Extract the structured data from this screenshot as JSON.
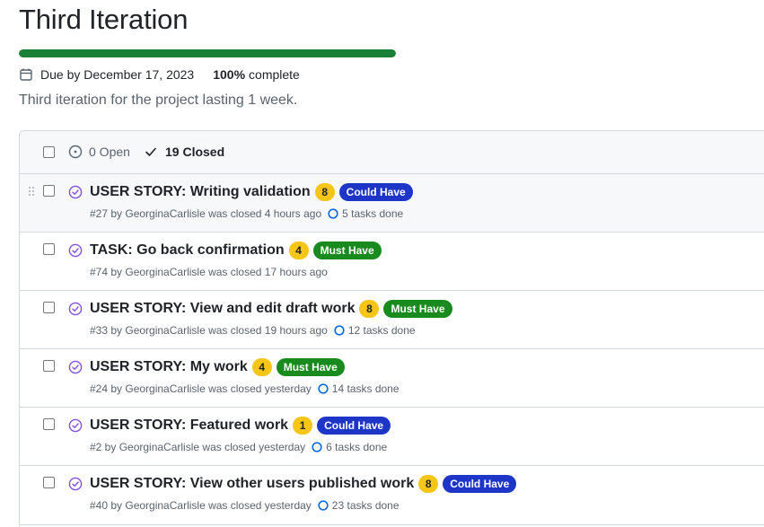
{
  "milestone": {
    "title": "Third Iteration",
    "progress_percent": 100,
    "due": "Due by December 17, 2023",
    "percent_label": "100%",
    "complete_word": "complete",
    "description": "Third iteration for the project lasting 1 week.",
    "accent_color": "#1a7f37"
  },
  "filters": {
    "open_label": "0 Open",
    "closed_label": "19 Closed"
  },
  "issues": [
    {
      "title": "USER STORY: Writing validation",
      "estimate": "8",
      "label": "Could Have",
      "meta": "#27 by GeorginaCarlisle was closed 4 hours ago",
      "tasks": "5 tasks done"
    },
    {
      "title": "TASK: Go back confirmation",
      "estimate": "4",
      "label": "Must Have",
      "meta": "#74 by GeorginaCarlisle was closed 17 hours ago",
      "tasks": ""
    },
    {
      "title": "USER STORY: View and edit draft work",
      "estimate": "8",
      "label": "Must Have",
      "meta": "#33 by GeorginaCarlisle was closed 19 hours ago",
      "tasks": "12 tasks done"
    },
    {
      "title": "USER STORY: My work",
      "estimate": "4",
      "label": "Must Have",
      "meta": "#24 by GeorginaCarlisle was closed yesterday",
      "tasks": "14 tasks done"
    },
    {
      "title": "USER STORY: Featured work",
      "estimate": "1",
      "label": "Could Have",
      "meta": "#2 by GeorginaCarlisle was closed yesterday",
      "tasks": "6 tasks done"
    },
    {
      "title": "USER STORY: View other users published work",
      "estimate": "8",
      "label": "Could Have",
      "meta": "#40 by GeorginaCarlisle was closed yesterday",
      "tasks": "23 tasks done"
    }
  ],
  "colors": {
    "could_have": "#1d36c8",
    "must_have": "#188a1e",
    "estimate": "#f5c518",
    "closed_icon": "#8250df",
    "task_ring": "#0969da"
  },
  "icons": {
    "due": "calendar-icon",
    "open": "issue-opened-icon",
    "closed": "check-icon",
    "issue_closed": "issue-closed-icon",
    "tasks": "task-progress-icon",
    "drag": "drag-handle-icon"
  }
}
